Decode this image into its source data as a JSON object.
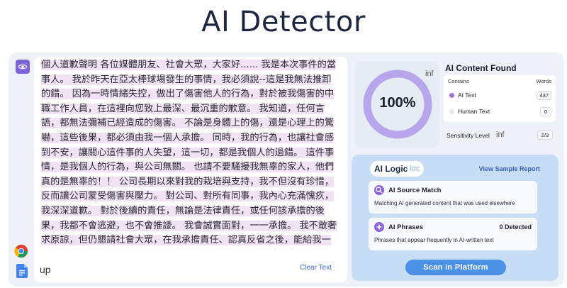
{
  "page": {
    "title": "AI Detector"
  },
  "input": {
    "text": "個人道歉聲明 各位媒體朋友、社會大眾，大家好...... 我是本次事件的當事人。 我於昨天在亞太棒球場發生的事情，我必須說--這是我無法推卸的錯。 因為一時情緒失控，做出了傷害他人的行為，對於被我傷害的中職工作人員，在這裡向您致上最深、最沉重的歉意。 我知道，任何言語，都無法彌補已經造成的傷害。 不論是身體上的傷，還是心理上的驚嚇，這些後果，都必須由我一個人承擔。 同時，我的行為，也讓社會感到不安，讓關心這件事的人失望，這一切，都是我個人的過錯。 這件事情，是我個人的行為，與公司無關。 也請不要騷擾我無辜的家人，他們真的是無辜的！！ 公司長期以來對我的栽培與支持，我不但沒有珍惜，反而讓公司蒙受傷害與壓力。 對公司、對所有同事，我內心充滿愧疚，我深深道歉。 對於後續的責任，無論是法律責任，或任何該承擔的後果，我都不會逃避，也不會推諉。 我會誠實面對，一一承擔。 我不敢奢求原諒，但仍懇請社會大眾，在我承擔責任、認真反省之後，能給我一個重新改過的機會。 最後，再次向受害者、向公司、向社會大眾--致上最深的歉意。",
    "field_value": "up",
    "clear_label": "Clear Text"
  },
  "result": {
    "percent": "100%",
    "percent_value": 100,
    "inf_label": "inf",
    "found_title": "AI Content Found",
    "col_contains": "Contains",
    "col_words": "Words",
    "rows": [
      {
        "label": "AI Text",
        "count": "437",
        "color": "#9a7ad6"
      },
      {
        "label": "Human Text",
        "count": "0",
        "color": "#e6e3f2"
      }
    ],
    "sensitivity_label": "Sensitivity Level",
    "sensitivity_value": "2/3"
  },
  "logic": {
    "title": "AI Logic",
    "title_suffix": "loc",
    "view_sample": "View Sample Report",
    "source_match": {
      "title": "AI Source Match",
      "desc": "Matching AI generated content that was used elsewhere"
    },
    "phrases": {
      "title": "AI Phrases",
      "count": "0 Detected",
      "desc": "Phrases that appear frequently in AI-written text"
    },
    "scan_label": "Scan in Platform"
  },
  "colors": {
    "accent": "#7d62d8",
    "ring": "#b8a6ec",
    "scan": "#4b92e6"
  }
}
